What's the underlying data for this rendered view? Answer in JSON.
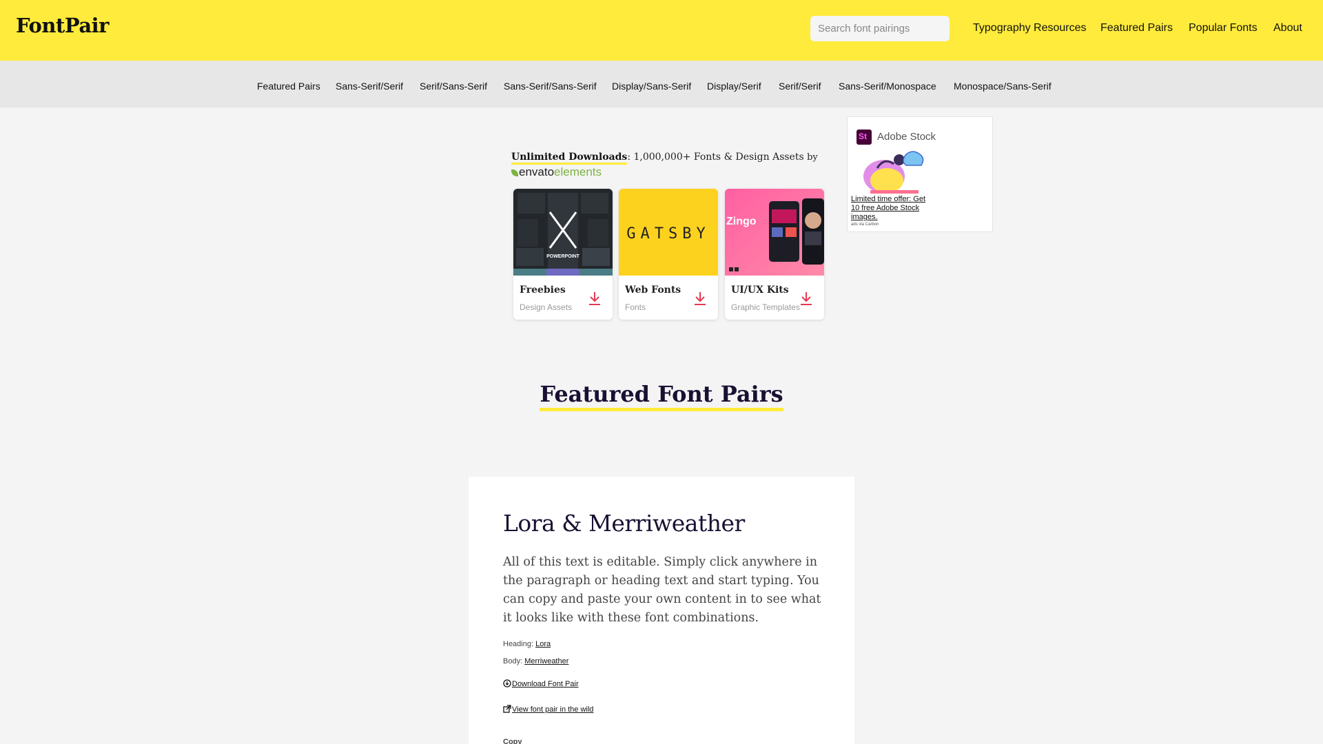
{
  "header": {
    "logo": "FontPair",
    "search_placeholder": "Search font pairings",
    "nav": [
      "Typography Resources",
      "Featured Pairs",
      "Popular Fonts",
      "About"
    ]
  },
  "categories": [
    "Featured Pairs",
    "Sans-Serif/Serif",
    "Serif/Sans-Serif",
    "Sans-Serif/Sans-Serif",
    "Display/Sans-Serif",
    "Display/Serif",
    "Serif/Serif",
    "Sans-Serif/Monospace",
    "Monospace/Sans-Serif"
  ],
  "promo": {
    "headline_strong": "Unlimited Downloads",
    "headline_rest": ": 1,000,000+ Fonts & Design Assets",
    "by": "by",
    "brand_part1": "envato",
    "brand_part2": "elements",
    "cards": [
      {
        "title": "Freebies",
        "subtitle": "Design Assets",
        "image_text": "POWERPOINT"
      },
      {
        "title": "Web Fonts",
        "subtitle": "Fonts",
        "image_text": "GATSBY"
      },
      {
        "title": "UI/UX Kits",
        "subtitle": "Graphic Templates",
        "image_text": "Zingo"
      }
    ]
  },
  "ad": {
    "brand": "Adobe Stock",
    "logo_text": "St",
    "text": "Limited time offer: Get 10 free Adobe Stock images.",
    "via": "ads via Carbon"
  },
  "section": {
    "title": "Featured Font Pairs"
  },
  "pair": {
    "heading": "Lora & Merriweather",
    "body": "All of this text is editable. Simply click anywhere in the paragraph or heading text and start typing. You can copy and paste your own content in to see what it looks like with these font combinations.",
    "heading_label": "Heading:",
    "heading_font": "Lora",
    "body_label": "Body:",
    "body_font": "Merriweather",
    "download": "Download Font Pair",
    "wild": "View font pair in the wild",
    "copy": "Copy"
  },
  "colors": {
    "header_bg": "#ffeb3b",
    "catbar_bg": "#e7e7e7",
    "page_bg": "#f4f4f4",
    "download_icon": "#e53950",
    "heading_text": "#1a1033"
  }
}
